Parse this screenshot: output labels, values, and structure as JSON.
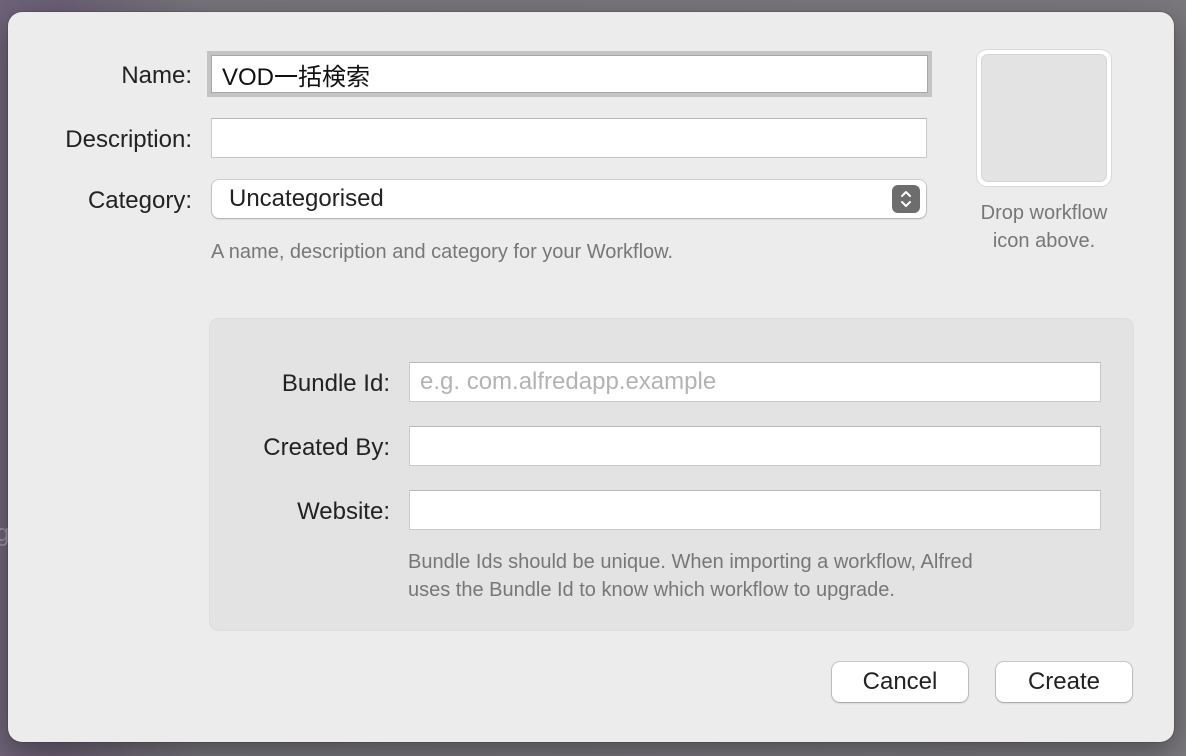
{
  "background": {
    "glyph": "g"
  },
  "form": {
    "name_label": "Name:",
    "name_value": "VOD一括検索",
    "description_label": "Description:",
    "description_value": "",
    "category_label": "Category:",
    "category_value": "Uncategorised",
    "hint": "A name, description and category for your Workflow."
  },
  "icon_drop": {
    "caption_line1": "Drop workflow",
    "caption_line2": "icon above."
  },
  "bundle": {
    "bundle_id_label": "Bundle Id:",
    "bundle_id_placeholder": "e.g. com.alfredapp.example",
    "created_by_label": "Created By:",
    "created_by_value": "",
    "website_label": "Website:",
    "website_value": "",
    "hint_line1": "Bundle Ids should be unique. When importing a workflow, Alfred",
    "hint_line2": "uses the Bundle Id to know which workflow to upgrade."
  },
  "buttons": {
    "cancel": "Cancel",
    "create": "Create"
  },
  "colors": {
    "dialog_bg": "#ececec",
    "panel_bg": "#e3e3e3",
    "stepper_bg": "#6d6d6d"
  }
}
